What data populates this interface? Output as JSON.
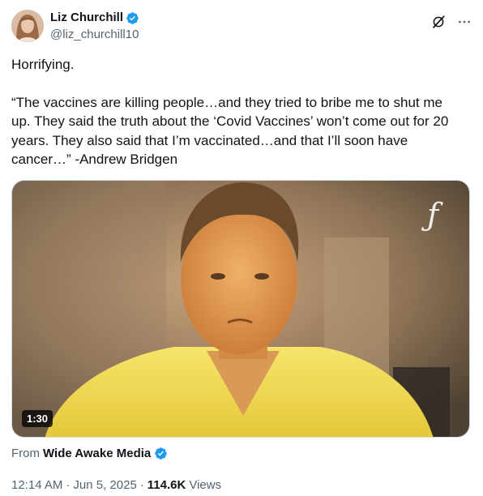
{
  "author": {
    "display_name": "Liz Churchill",
    "handle": "@liz_churchill10",
    "verified": true
  },
  "tweet": {
    "paragraph_1": "Horrifying.",
    "paragraph_2": "“The vaccines are killing people…and they tried to bribe me to shut me up. They said the truth about the ‘Covid Vaccines’ won’t come out for 20 years. They also said that I’m vaccinated…and that I’ll soon have cancer…” -Andrew Bridgen"
  },
  "media": {
    "duration": "1:30",
    "watermark_icon": "script-f-logo"
  },
  "source": {
    "prefix": "From",
    "name": "Wide Awake Media",
    "verified": true
  },
  "meta": {
    "time": "12:14 AM",
    "date": "Jun 5, 2025",
    "views_count": "114.6K",
    "views_label": "Views",
    "separator": "·"
  },
  "icons": {
    "header_actions": [
      "grok-icon",
      "more-icon"
    ]
  },
  "colors": {
    "verified_blue": "#1d9bf0",
    "secondary_text": "#536471",
    "primary_text": "#0f1419"
  }
}
